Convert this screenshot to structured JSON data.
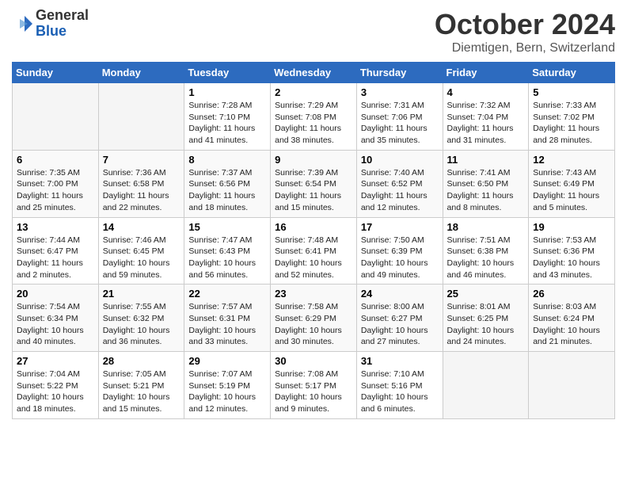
{
  "logo": {
    "general": "General",
    "blue": "Blue"
  },
  "header": {
    "month": "October 2024",
    "location": "Diemtigen, Bern, Switzerland"
  },
  "days_of_week": [
    "Sunday",
    "Monday",
    "Tuesday",
    "Wednesday",
    "Thursday",
    "Friday",
    "Saturday"
  ],
  "weeks": [
    [
      {
        "day": "",
        "empty": true
      },
      {
        "day": "",
        "empty": true
      },
      {
        "day": "1",
        "sunrise": "7:28 AM",
        "sunset": "7:10 PM",
        "daylight": "11 hours and 41 minutes."
      },
      {
        "day": "2",
        "sunrise": "7:29 AM",
        "sunset": "7:08 PM",
        "daylight": "11 hours and 38 minutes."
      },
      {
        "day": "3",
        "sunrise": "7:31 AM",
        "sunset": "7:06 PM",
        "daylight": "11 hours and 35 minutes."
      },
      {
        "day": "4",
        "sunrise": "7:32 AM",
        "sunset": "7:04 PM",
        "daylight": "11 hours and 31 minutes."
      },
      {
        "day": "5",
        "sunrise": "7:33 AM",
        "sunset": "7:02 PM",
        "daylight": "11 hours and 28 minutes."
      }
    ],
    [
      {
        "day": "6",
        "sunrise": "7:35 AM",
        "sunset": "7:00 PM",
        "daylight": "11 hours and 25 minutes."
      },
      {
        "day": "7",
        "sunrise": "7:36 AM",
        "sunset": "6:58 PM",
        "daylight": "11 hours and 22 minutes."
      },
      {
        "day": "8",
        "sunrise": "7:37 AM",
        "sunset": "6:56 PM",
        "daylight": "11 hours and 18 minutes."
      },
      {
        "day": "9",
        "sunrise": "7:39 AM",
        "sunset": "6:54 PM",
        "daylight": "11 hours and 15 minutes."
      },
      {
        "day": "10",
        "sunrise": "7:40 AM",
        "sunset": "6:52 PM",
        "daylight": "11 hours and 12 minutes."
      },
      {
        "day": "11",
        "sunrise": "7:41 AM",
        "sunset": "6:50 PM",
        "daylight": "11 hours and 8 minutes."
      },
      {
        "day": "12",
        "sunrise": "7:43 AM",
        "sunset": "6:49 PM",
        "daylight": "11 hours and 5 minutes."
      }
    ],
    [
      {
        "day": "13",
        "sunrise": "7:44 AM",
        "sunset": "6:47 PM",
        "daylight": "11 hours and 2 minutes."
      },
      {
        "day": "14",
        "sunrise": "7:46 AM",
        "sunset": "6:45 PM",
        "daylight": "10 hours and 59 minutes."
      },
      {
        "day": "15",
        "sunrise": "7:47 AM",
        "sunset": "6:43 PM",
        "daylight": "10 hours and 56 minutes."
      },
      {
        "day": "16",
        "sunrise": "7:48 AM",
        "sunset": "6:41 PM",
        "daylight": "10 hours and 52 minutes."
      },
      {
        "day": "17",
        "sunrise": "7:50 AM",
        "sunset": "6:39 PM",
        "daylight": "10 hours and 49 minutes."
      },
      {
        "day": "18",
        "sunrise": "7:51 AM",
        "sunset": "6:38 PM",
        "daylight": "10 hours and 46 minutes."
      },
      {
        "day": "19",
        "sunrise": "7:53 AM",
        "sunset": "6:36 PM",
        "daylight": "10 hours and 43 minutes."
      }
    ],
    [
      {
        "day": "20",
        "sunrise": "7:54 AM",
        "sunset": "6:34 PM",
        "daylight": "10 hours and 40 minutes."
      },
      {
        "day": "21",
        "sunrise": "7:55 AM",
        "sunset": "6:32 PM",
        "daylight": "10 hours and 36 minutes."
      },
      {
        "day": "22",
        "sunrise": "7:57 AM",
        "sunset": "6:31 PM",
        "daylight": "10 hours and 33 minutes."
      },
      {
        "day": "23",
        "sunrise": "7:58 AM",
        "sunset": "6:29 PM",
        "daylight": "10 hours and 30 minutes."
      },
      {
        "day": "24",
        "sunrise": "8:00 AM",
        "sunset": "6:27 PM",
        "daylight": "10 hours and 27 minutes."
      },
      {
        "day": "25",
        "sunrise": "8:01 AM",
        "sunset": "6:25 PM",
        "daylight": "10 hours and 24 minutes."
      },
      {
        "day": "26",
        "sunrise": "8:03 AM",
        "sunset": "6:24 PM",
        "daylight": "10 hours and 21 minutes."
      }
    ],
    [
      {
        "day": "27",
        "sunrise": "7:04 AM",
        "sunset": "5:22 PM",
        "daylight": "10 hours and 18 minutes."
      },
      {
        "day": "28",
        "sunrise": "7:05 AM",
        "sunset": "5:21 PM",
        "daylight": "10 hours and 15 minutes."
      },
      {
        "day": "29",
        "sunrise": "7:07 AM",
        "sunset": "5:19 PM",
        "daylight": "10 hours and 12 minutes."
      },
      {
        "day": "30",
        "sunrise": "7:08 AM",
        "sunset": "5:17 PM",
        "daylight": "10 hours and 9 minutes."
      },
      {
        "day": "31",
        "sunrise": "7:10 AM",
        "sunset": "5:16 PM",
        "daylight": "10 hours and 6 minutes."
      },
      {
        "day": "",
        "empty": true
      },
      {
        "day": "",
        "empty": true
      }
    ]
  ],
  "labels": {
    "sunrise_prefix": "Sunrise: ",
    "sunset_prefix": "Sunset: ",
    "daylight_prefix": "Daylight: "
  }
}
